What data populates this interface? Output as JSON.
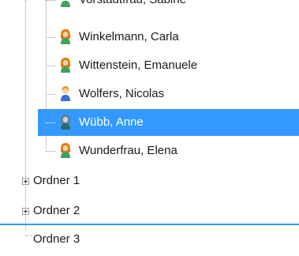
{
  "tree": {
    "partial_item": {
      "label": "Vorstadtfrau, Sabine"
    },
    "people": [
      {
        "label": "Winkelmann, Carla",
        "icon": "female-user-icon",
        "selected": false
      },
      {
        "label": "Wittenstein, Emanuele",
        "icon": "female-user-icon",
        "selected": false
      },
      {
        "label": "Wolfers, Nicolas",
        "icon": "male-user-icon",
        "selected": false
      },
      {
        "label": "Wübb, Anne",
        "icon": "female-user-icon",
        "selected": true
      },
      {
        "label": "Wunderfrau, Elena",
        "icon": "female-user-icon",
        "selected": false
      }
    ],
    "folders": [
      {
        "label": "Ordner 1",
        "expandable": true
      },
      {
        "label": "Ordner 2",
        "expandable": true
      },
      {
        "label": "Ordner 3",
        "expandable": false
      }
    ]
  },
  "colors": {
    "selection": "#3399ff",
    "drop_indicator": "#3399ff",
    "female_icon_hair": "#e07a10",
    "female_icon_body": "#3da35d",
    "male_icon_hair": "#e0a020",
    "male_icon_body": "#3a6fd8"
  }
}
